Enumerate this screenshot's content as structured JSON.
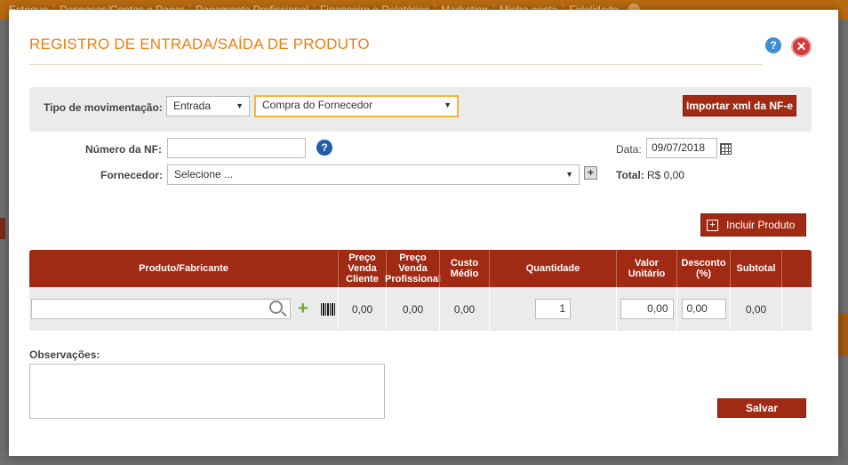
{
  "background_nav": [
    "Estoque",
    "Despesas/Contas a Pagar",
    "Pagamento Profissional",
    "Financeiro e Relatórios",
    "Marketing",
    "Minha conta",
    "Fidelidade"
  ],
  "modal": {
    "title": "REGISTRO DE ENTRADA/SAÍDA DE PRODUTO",
    "help_glyph": "?",
    "close_glyph": "✕"
  },
  "movement": {
    "label": "Tipo de movimentação:",
    "type_value": "Entrada",
    "reason_value": "Compra do Fornecedor",
    "import_button": "Importar xml da NF-e"
  },
  "invoice": {
    "nf_label": "Número da NF:",
    "nf_value": "",
    "supplier_label": "Fornecedor:",
    "supplier_value": "Selecione ...",
    "date_label": "Data:",
    "date_value": "09/07/2018",
    "total_label": "Total:",
    "total_value": "R$ 0,00"
  },
  "add_product_button": "Incluir Produto",
  "table": {
    "headers": {
      "product": "Produto/Fabricante",
      "price_client": "Preço Venda Cliente",
      "price_professional": "Preço Venda Profissional",
      "avg_cost": "Custo Médio",
      "quantity": "Quantidade",
      "unit_value": "Valor Unitário",
      "discount": "Desconto (%)",
      "subtotal": "Subtotal"
    },
    "row": {
      "product_value": "",
      "price_client": "0,00",
      "price_professional": "0,00",
      "avg_cost": "0,00",
      "quantity": "1",
      "unit_value": "0,00",
      "discount": "0,00",
      "subtotal": "0,00"
    }
  },
  "notes": {
    "label": "Observações:",
    "value": ""
  },
  "save_button": "Salvar",
  "colors": {
    "accent_orange": "#f07d0e",
    "table_header_red": "#a12a14",
    "help_blue": "#3e8ed0",
    "close_red": "#d43a3a"
  }
}
